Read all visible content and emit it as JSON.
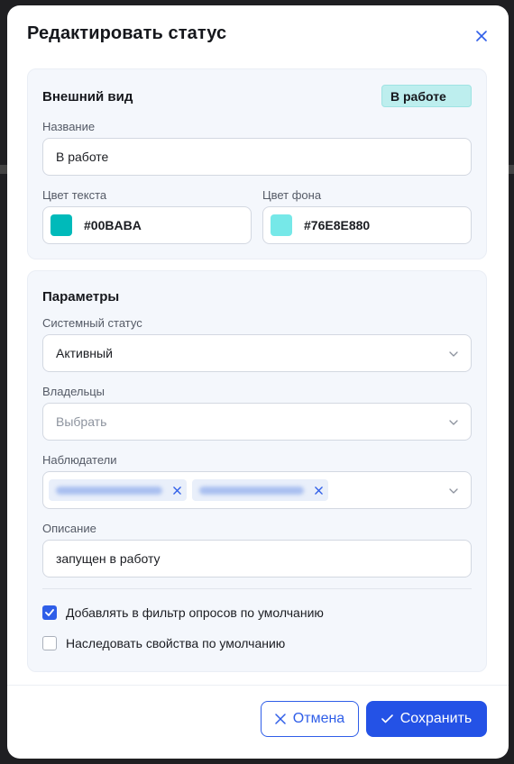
{
  "dialog": {
    "title": "Редактировать статус"
  },
  "appearance": {
    "title": "Внешний вид",
    "badge_label": "В работе",
    "name_label": "Название",
    "name_value": "В работе",
    "text_color_label": "Цвет текста",
    "text_color_value": "#00BABA",
    "bg_color_label": "Цвет фона",
    "bg_color_value": "#76E8E880"
  },
  "params": {
    "title": "Параметры",
    "system_status_label": "Системный статус",
    "system_status_value": "Активный",
    "owners_label": "Владельцы",
    "owners_placeholder": "Выбрать",
    "watchers_label": "Наблюдатели",
    "description_label": "Описание",
    "description_value": "запущен в работу",
    "checkbox_filter_label": "Добавлять в фильтр опросов по умолчанию",
    "checkbox_filter_checked": true,
    "checkbox_inherit_label": "Наследовать свойства по умолчанию",
    "checkbox_inherit_checked": false
  },
  "footer": {
    "cancel_label": "Отмена",
    "save_label": "Сохранить"
  },
  "colors": {
    "accent": "#2452E6",
    "text_swatch": "#00BABA",
    "bg_swatch": "#76E8E8",
    "badge_bg": "#BDEEEE"
  },
  "icons": {
    "close": "close-icon",
    "caret": "chevron-down-icon",
    "chip_remove": "close-icon",
    "checkmark": "check-icon"
  }
}
